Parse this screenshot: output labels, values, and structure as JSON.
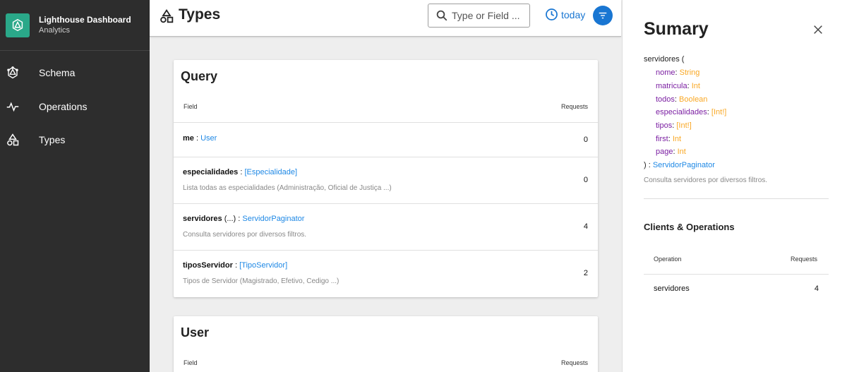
{
  "sidebar": {
    "brand_title": "Lighthouse Dashboard",
    "brand_subtitle": "Analytics",
    "items": [
      {
        "label": "Schema",
        "icon": "schema-icon"
      },
      {
        "label": "Operations",
        "icon": "pulse-icon"
      },
      {
        "label": "Types",
        "icon": "shapes-icon"
      }
    ]
  },
  "header": {
    "title": "Types",
    "search_placeholder": "Type or Field ...",
    "date_label": "today"
  },
  "cards": [
    {
      "title": "Query",
      "col_field": "Field",
      "col_requests": "Requests",
      "rows": [
        {
          "name": "me",
          "args": "",
          "sep": " : ",
          "type": "User",
          "desc": "",
          "count": "0"
        },
        {
          "name": "especialidades",
          "args": "",
          "sep": " : ",
          "type": "[Especialidade]",
          "desc": "Lista todas as especialidades (Administração, Oficial de Justiça ...)",
          "count": "0"
        },
        {
          "name": "servidores",
          "args": " (...)",
          "sep": " : ",
          "type": "ServidorPaginator",
          "desc": "Consulta servidores por diversos filtros.",
          "count": "4"
        },
        {
          "name": "tiposServidor",
          "args": "",
          "sep": " : ",
          "type": "[TipoServidor]",
          "desc": "Tipos de Servidor (Magistrado, Efetivo, Cedigo ...)",
          "count": "2"
        }
      ]
    },
    {
      "title": "User",
      "col_field": "Field",
      "col_requests": "Requests"
    }
  ],
  "panel": {
    "title": "Sumary",
    "field_name": "servidores",
    "open_paren": " (",
    "args": [
      {
        "name": "nome",
        "type": "String"
      },
      {
        "name": "matricula",
        "type": "Int"
      },
      {
        "name": "todos",
        "type": "Boolean"
      },
      {
        "name": "especialidades",
        "type": "[Int!]"
      },
      {
        "name": "tipos",
        "type": "[Int!]"
      },
      {
        "name": "first",
        "type": "Int"
      },
      {
        "name": "page",
        "type": "Int"
      }
    ],
    "close_paren": ") : ",
    "return_type": "ServidorPaginator",
    "description": "Consulta servidores por diversos filtros.",
    "clients_title": "Clients & Operations",
    "col_operation": "Operation",
    "col_requests": "Requests",
    "operations": [
      {
        "name": "servidores",
        "count": "4"
      }
    ]
  },
  "colors": {
    "sidebar_bg": "#2d2d2d",
    "brand_logo": "#2aa889",
    "accent": "#1976d2",
    "type_link": "#1e88e5",
    "arg_name": "#7b1fa2",
    "arg_type": "#f9a825"
  }
}
